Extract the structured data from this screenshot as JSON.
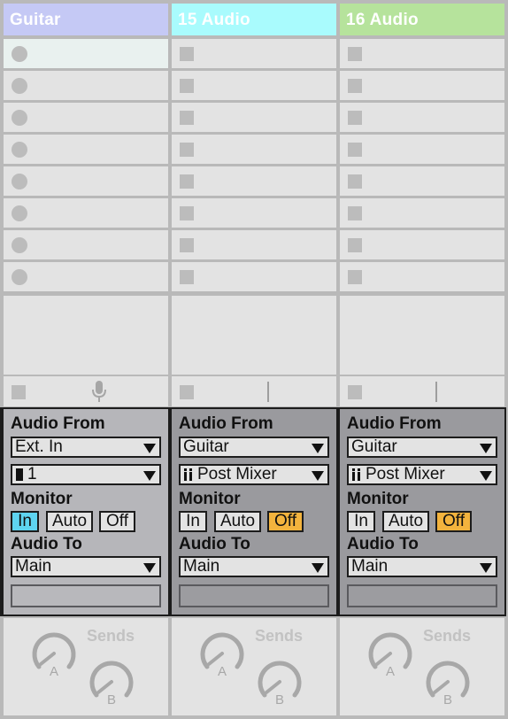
{
  "colors": {
    "guitar_header": "#c5c9f5",
    "audio15_header": "#a9fbfd",
    "audio16_header": "#b6e39c",
    "monitor_in_active": "#5ed4f0",
    "monitor_off_active": "#f3b33d"
  },
  "tracks": [
    {
      "name": "Guitar",
      "slot_type": "record-dot",
      "audio_from_label": "Audio From",
      "audio_from": "Ext. In",
      "channel": "1",
      "monitor_label": "Monitor",
      "monitor": {
        "in": "In",
        "auto": "Auto",
        "off": "Off",
        "active": "In"
      },
      "audio_to_label": "Audio To",
      "audio_to": "Main",
      "sends_label": "Sends",
      "send_a": "A",
      "send_b": "B"
    },
    {
      "name": "15 Audio",
      "slot_type": "stop-square",
      "audio_from_label": "Audio From",
      "audio_from": "Guitar",
      "channel": "Post Mixer",
      "monitor_label": "Monitor",
      "monitor": {
        "in": "In",
        "auto": "Auto",
        "off": "Off",
        "active": "Off"
      },
      "audio_to_label": "Audio To",
      "audio_to": "Main",
      "sends_label": "Sends",
      "send_a": "A",
      "send_b": "B"
    },
    {
      "name": "16 Audio",
      "slot_type": "stop-square",
      "audio_from_label": "Audio From",
      "audio_from": "Guitar",
      "channel": "Post Mixer",
      "monitor_label": "Monitor",
      "monitor": {
        "in": "In",
        "auto": "Auto",
        "off": "Off",
        "active": "Off"
      },
      "audio_to_label": "Audio To",
      "audio_to": "Main",
      "sends_label": "Sends",
      "send_a": "A",
      "send_b": "B"
    }
  ],
  "icons": {
    "clip_slot_record": "record-dot-icon",
    "clip_slot_stop": "stop-square-icon",
    "arm": "microphone-icon",
    "dropdown": "triangle-down-icon",
    "mono_channel": "mono-channel-icon",
    "stereo_channel": "stereo-channel-icon",
    "send_knob": "knob-icon"
  }
}
